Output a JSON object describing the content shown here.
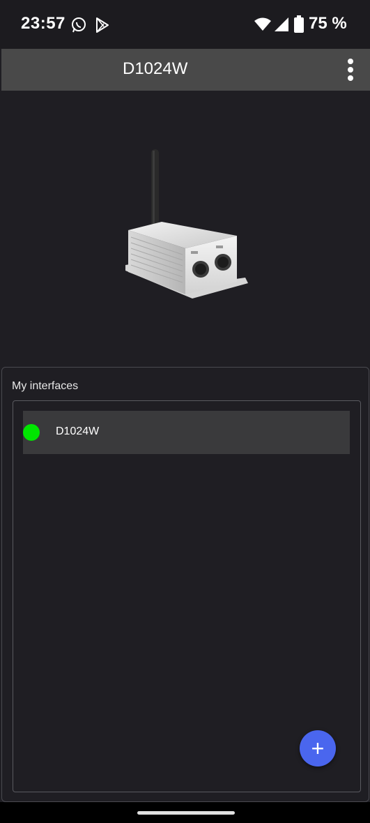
{
  "status_bar": {
    "time": "23:57",
    "notification_icons": [
      "whatsapp-icon",
      "play-store-icon"
    ],
    "system_icons": [
      "wifi-icon",
      "cell-signal-icon",
      "battery-icon"
    ],
    "battery_percent": "75 %"
  },
  "app_bar": {
    "title": "D1024W",
    "menu_icon": "more-vert-icon"
  },
  "hero": {
    "image": "dmx-interface-device"
  },
  "interfaces": {
    "title": "My interfaces",
    "items": [
      {
        "label": "D1024W",
        "status_color": "#00e600"
      }
    ]
  },
  "fab": {
    "label": "+",
    "color": "#4a66ee"
  }
}
